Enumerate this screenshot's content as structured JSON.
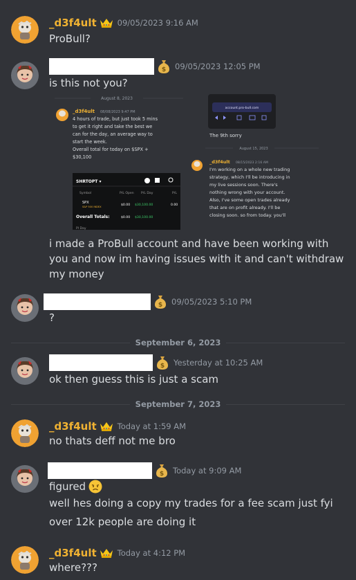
{
  "messages": {
    "m1": {
      "username": "_d3f4ult",
      "timestamp": "09/05/2023 9:16 AM",
      "text": "ProBull?"
    },
    "m2": {
      "timestamp": "09/05/2023 12:05 PM",
      "text": "is this not you?"
    },
    "m2_body": "i made a ProBull account and have been working with you and now im having issues with it and can't withdraw my money",
    "m3": {
      "timestamp": "09/05/2023 5:10 PM",
      "text": "?"
    },
    "m4": {
      "timestamp": "Yesterday at 10:25 AM",
      "text": "ok then guess this is just a scam"
    },
    "m5": {
      "username": "_d3f4ult",
      "timestamp": "Today at 1:59 AM",
      "text": "no thats deff not me bro"
    },
    "m6": {
      "timestamp": "Today at 9:09 AM",
      "line1": "figured",
      "line2": "well hes doing a copy my trades for a fee scam just fyi",
      "line3": "over 12k people are doing it"
    },
    "m7": {
      "username": "_d3f4ult",
      "timestamp": "Today at 4:12 PM",
      "text": "where???"
    }
  },
  "separators": {
    "s1": "September 6, 2023",
    "s2": "September 7, 2023"
  },
  "screenshot": {
    "date1": "August 8, 2023",
    "left_user": "_d3f4ult",
    "left_ts": "08/08/2023 9:47 PM",
    "left_lines": [
      "4 hours of trade, but just took 5 mins",
      "to get it right and take the best we",
      "can for the day, an average way to",
      "start the week.",
      "Overall total for today on $SPX +",
      "$30,100"
    ],
    "panel_title": "SHRTOPT ▾",
    "panel_cols": [
      "Symbol",
      "P/L Open",
      "P/L Day",
      "P/L"
    ],
    "panel_row_symbol": "SPX",
    "panel_row_sub": "S&P 500 INDEX",
    "panel_row_vals": [
      "$0.00",
      "$30,100.00",
      "0.00"
    ],
    "panel_totals_label": "Overall Totals:",
    "panel_totals_vals": [
      "$0.00",
      "$30,100.00"
    ],
    "panel_footer": "Pl Day",
    "url": "account.pro-bull.com",
    "right_caption": "The 9th sorry",
    "date2": "August 15, 2023",
    "right_user": "_d3f4ult",
    "right_ts": "08/15/2023 2:16 AM",
    "right_lines": [
      "I'm working on a whole new trading",
      "strategy, which I'll be introducing in",
      "my live sessions soon. There's",
      "nothing wrong with your account.",
      "Also, I've some open trades already",
      "that are on profit already. I'll be",
      "closing soon. so from today. you'll"
    ]
  },
  "colors": {
    "username": "#f0b232",
    "background": "#313338",
    "muted": "#949ba4",
    "text": "#dbdee1"
  },
  "icons": {
    "crown": "crown-icon",
    "money": "money-bag-icon"
  }
}
